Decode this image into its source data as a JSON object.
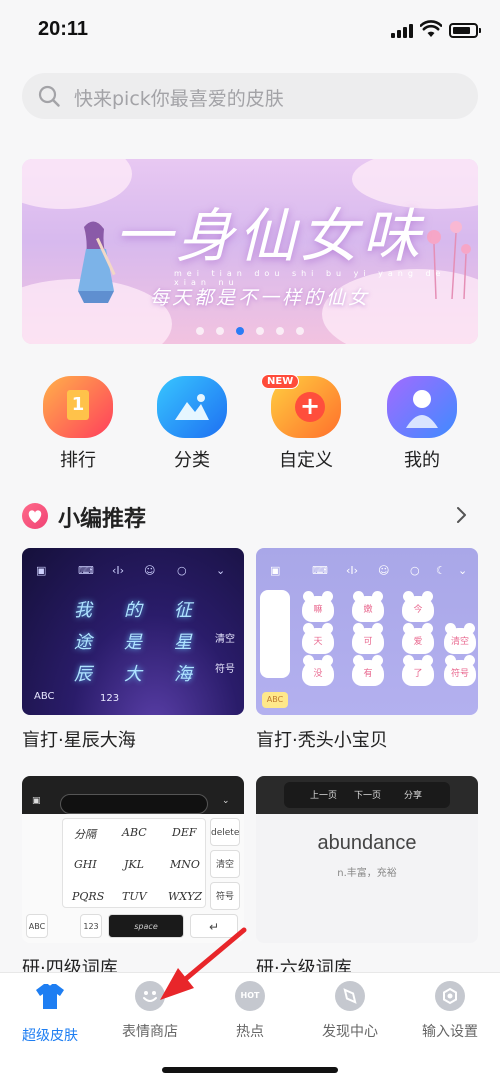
{
  "status_bar": {
    "time": "20:11"
  },
  "search": {
    "placeholder": "快来pick你最喜爱的皮肤"
  },
  "banner": {
    "title": "一身仙女味",
    "pinyin": "mei tian dou shi bu yi yang de xian nu",
    "subtitle": "每天都是不一样的仙女",
    "slide_count": 6,
    "active_slide": 3
  },
  "quick_entries": [
    {
      "label": "排行",
      "icon": "ranking-icon",
      "glyph": "1"
    },
    {
      "label": "分类",
      "icon": "category-icon",
      "glyph": ""
    },
    {
      "label": "自定义",
      "icon": "custom-plus-icon",
      "glyph": "+",
      "badge": "NEW"
    },
    {
      "label": "我的",
      "icon": "user-profile-icon",
      "glyph": ""
    }
  ],
  "section": {
    "title": "小编推荐"
  },
  "cards": [
    {
      "caption": "盲打·星辰大海",
      "keys": [
        "我",
        "的",
        "征",
        "途",
        "是",
        "星",
        "辰",
        "大",
        "海"
      ],
      "side_keys": [
        "清空",
        "符号"
      ],
      "bottom_keys": [
        "ABC",
        "123"
      ]
    },
    {
      "caption": "盲打·秃头小宝贝",
      "keys": [
        "嘛",
        "嫩",
        "今",
        "天",
        "可",
        "爱",
        "没",
        "有",
        "了"
      ],
      "side_keys": [
        "清空",
        "符号"
      ],
      "bottom_keys": [
        "ABC"
      ]
    },
    {
      "caption": "研·四级词库",
      "keys": [
        "分隔",
        "ABC",
        "DEF",
        "GHI",
        "JKL",
        "MNO",
        "PQRS",
        "TUV",
        "WXYZ"
      ],
      "side_keys": [
        "delete",
        "清空",
        "符号"
      ],
      "bottom_keys": [
        "ABC",
        "123",
        "space",
        "↵"
      ]
    },
    {
      "caption": "研·六级词库",
      "bar_buttons": [
        "上一页",
        "下一页",
        "分享"
      ],
      "word": "abundance",
      "meaning": "n.丰富，充裕"
    }
  ],
  "tabs": [
    {
      "label": "超级皮肤",
      "icon": "tshirt-icon",
      "active": true
    },
    {
      "label": "表情商店",
      "icon": "emoji-face-icon",
      "active": false
    },
    {
      "label": "热点",
      "icon": "hot-icon",
      "glyph": "HOT",
      "active": false
    },
    {
      "label": "发现中心",
      "icon": "compass-icon",
      "active": false
    },
    {
      "label": "输入设置",
      "icon": "settings-hexagon-icon",
      "active": false
    }
  ],
  "colors": {
    "accent_blue": "#1e7ef2",
    "annotation_arrow": "#e8262a",
    "ranking_icon": "#ff5d4f",
    "category_icon": "#1e90ff",
    "custom_icon": "#ff8a2b",
    "profile_icon": "#6b5cff"
  }
}
